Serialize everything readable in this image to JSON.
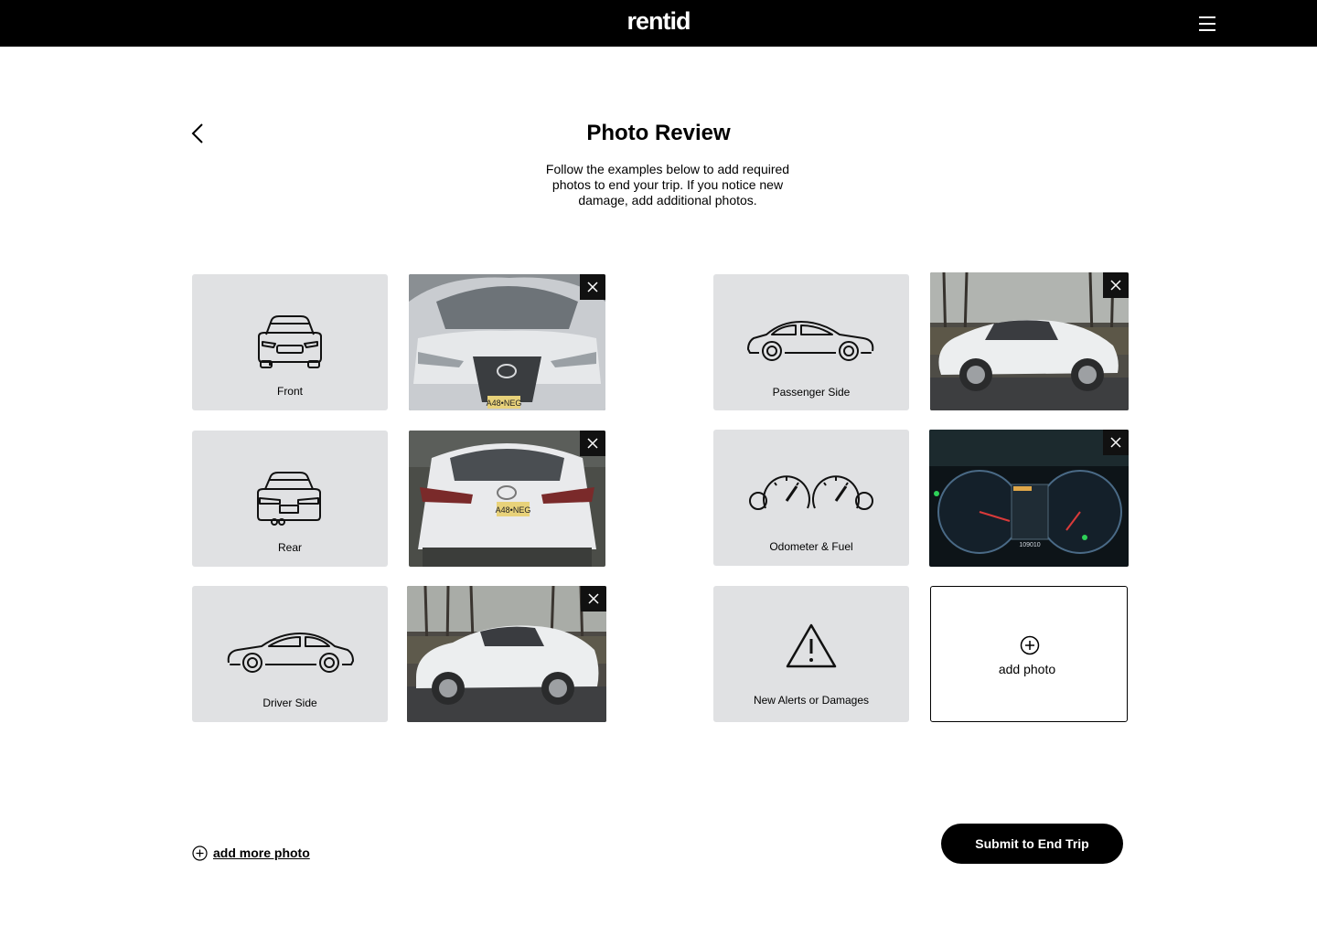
{
  "header": {
    "logo": "rentid",
    "menu_icon": "hamburger-menu-icon"
  },
  "page": {
    "back_icon": "chevron-left-icon",
    "title": "Photo Review",
    "subtitle": "Follow the examples below to add required photos to end your trip. If you notice new damage, add additional photos."
  },
  "slots": [
    {
      "label": "Front",
      "icon": "car-front-icon",
      "photo": "front-photo"
    },
    {
      "label": "Rear",
      "icon": "car-rear-icon",
      "photo": "rear-photo"
    },
    {
      "label": "Driver Side",
      "icon": "car-side-icon",
      "photo": "driver-side-photo"
    },
    {
      "label": "Passenger Side",
      "icon": "car-side-icon",
      "photo": "passenger-side-photo"
    },
    {
      "label": "Odometer & Fuel",
      "icon": "gauges-icon",
      "photo": "odometer-photo"
    },
    {
      "label": "New Alerts or Damages",
      "icon": "warning-icon",
      "photo": null
    }
  ],
  "photo_text": {
    "front_plate": "A48•NEG",
    "rear_plate": "A48•NEG",
    "odometer_reading": "109010"
  },
  "add_photo": {
    "label": "add photo",
    "icon": "plus-circle-icon"
  },
  "footer": {
    "add_more_label": "add more photo",
    "add_more_icon": "plus-circle-icon",
    "submit_label": "Submit to End Trip"
  },
  "colors": {
    "header_bg": "#000000",
    "tile_bg": "#e0e1e3",
    "accent": "#000000"
  }
}
